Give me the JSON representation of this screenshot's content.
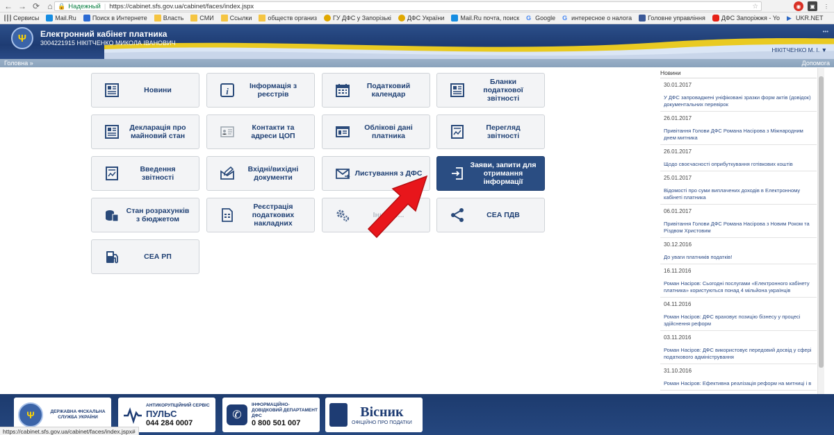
{
  "browser": {
    "secure_label": "Надежный",
    "url": "https://cabinet.sfs.gov.ua/cabinet/faces/index.jspx",
    "bookmarks": [
      {
        "label": "Сервисы"
      },
      {
        "label": "Mail.Ru"
      },
      {
        "label": "Поиск в Интернете"
      },
      {
        "label": "Власть"
      },
      {
        "label": "СМИ"
      },
      {
        "label": "Ссылки"
      },
      {
        "label": "обществ организ"
      },
      {
        "label": "ГУ ДФС у Запорізькі"
      },
      {
        "label": "ДФС України"
      },
      {
        "label": "Mail.Ru почта, поиск"
      },
      {
        "label": "Google"
      },
      {
        "label": "интересное о налога"
      },
      {
        "label": "Головне управління"
      },
      {
        "label": "ДФС Запоріжжя - Yo"
      },
      {
        "label": "UKR.NET"
      }
    ],
    "status_url": "https://cabinet.sfs.gov.ua/cabinet/faces/index.jspx#"
  },
  "header": {
    "title": "Електронний кабінет платника",
    "taxpayer": "3004221915 НІКІТЧЕНКО МИКОЛА ІВАНОВИЧ",
    "user": "НІКІТЧЕНКО М. І.",
    "user_caret": "▼"
  },
  "crumbs": {
    "home": "Головна",
    "home_sep": "»",
    "help": "Допомога"
  },
  "tiles": [
    {
      "label": "Новини",
      "icon": "newspaper-icon"
    },
    {
      "label": "Інформація з реєстрів",
      "icon": "info-icon"
    },
    {
      "label": "Податковий календар",
      "icon": "calendar-icon"
    },
    {
      "label": "Бланки податкової звітності",
      "icon": "forms-icon"
    },
    {
      "label": "Декларація про майновий стан",
      "icon": "declaration-icon"
    },
    {
      "label": "Контакти та адреси ЦОП",
      "icon": "contacts-icon"
    },
    {
      "label": "Облікові дані платника",
      "icon": "account-data-icon"
    },
    {
      "label": "Перегляд звітності",
      "icon": "report-view-icon"
    },
    {
      "label": "Введення звітності",
      "icon": "report-input-icon"
    },
    {
      "label": "Вхідні/вихідні документи",
      "icon": "envelope-pen-icon"
    },
    {
      "label": "Листування з ДФС",
      "icon": "mail-send-icon"
    },
    {
      "label": "Заяви, запити для отримання інформації",
      "icon": "sign-in-icon"
    },
    {
      "label": "Стан розрахунків з бюджетом",
      "icon": "coins-icon"
    },
    {
      "label": "Реєстрація податкових накладних",
      "icon": "invoice-icon"
    },
    {
      "label": "Інші ер...",
      "icon": "gears-icon"
    },
    {
      "label": "СЕА ПДВ",
      "icon": "share-icon"
    },
    {
      "label": "СЕА РП",
      "icon": "fuel-icon"
    }
  ],
  "news": {
    "title": "Новини",
    "items": [
      {
        "date": "30.01.2017",
        "text": "У ДФС запроваджені уніфіковані зразки форм актів (довідок) документальних перевірок"
      },
      {
        "date": "26.01.2017",
        "text": "Привітання Голови ДФС Романа Насірова з Міжнародним днем митника"
      },
      {
        "date": "26.01.2017",
        "text": "Щодо своєчасності оприбуткування готівкових коштів"
      },
      {
        "date": "25.01.2017",
        "text": "Відомості про суми виплачених доходів в Електронному кабінеті платника"
      },
      {
        "date": "06.01.2017",
        "text": "Привітання Голови ДФС Романа Насірова з Новим Роком та Різдвом Христовим"
      },
      {
        "date": "30.12.2016",
        "text": "До уваги платників податків!"
      },
      {
        "date": "16.11.2016",
        "text": "Роман Насіров: Сьогодні послугами «Електронного кабінету платника» користуються понад 4 мільйона українців"
      },
      {
        "date": "04.11.2016",
        "text": "Роман Насіров: ДФС враховує позицію бізнесу у процесі здійснення реформ"
      },
      {
        "date": "03.11.2016",
        "text": "Роман Насіров: ДФС використовує передовий досвід у сфері податкового адміністрування"
      },
      {
        "date": "31.10.2016",
        "text": "Роман Насіров: Ефективна реалізація реформ на митниці і в"
      }
    ]
  },
  "footer": {
    "dfs": "ДЕРЖАВНА ФІСКАЛЬНА СЛУЖБА УКРАЇНИ",
    "anticorr_title": "АНТИКОРУПЦІЙНИЙ СЕРВІС",
    "anticorr_name": "ПУЛЬС",
    "anticorr_phone": "044 284 0007",
    "info_title": "ІНФОРМАЦІЙНО-ДОВІДКОВИЙ ДЕПАРТАМЕНТ ДФС",
    "info_phone": "0 800 501 007",
    "visnyk_title": "Вісник",
    "visnyk_sub": "ОФІЦІЙНО ПРО ПОДАТКИ"
  },
  "colors": {
    "header_blue": "#1e3c73",
    "tile_bg": "#f3f4f6",
    "tile_active": "#2a4d82",
    "accent_yellow": "#ffd500",
    "arrow_red": "#e8161b"
  }
}
